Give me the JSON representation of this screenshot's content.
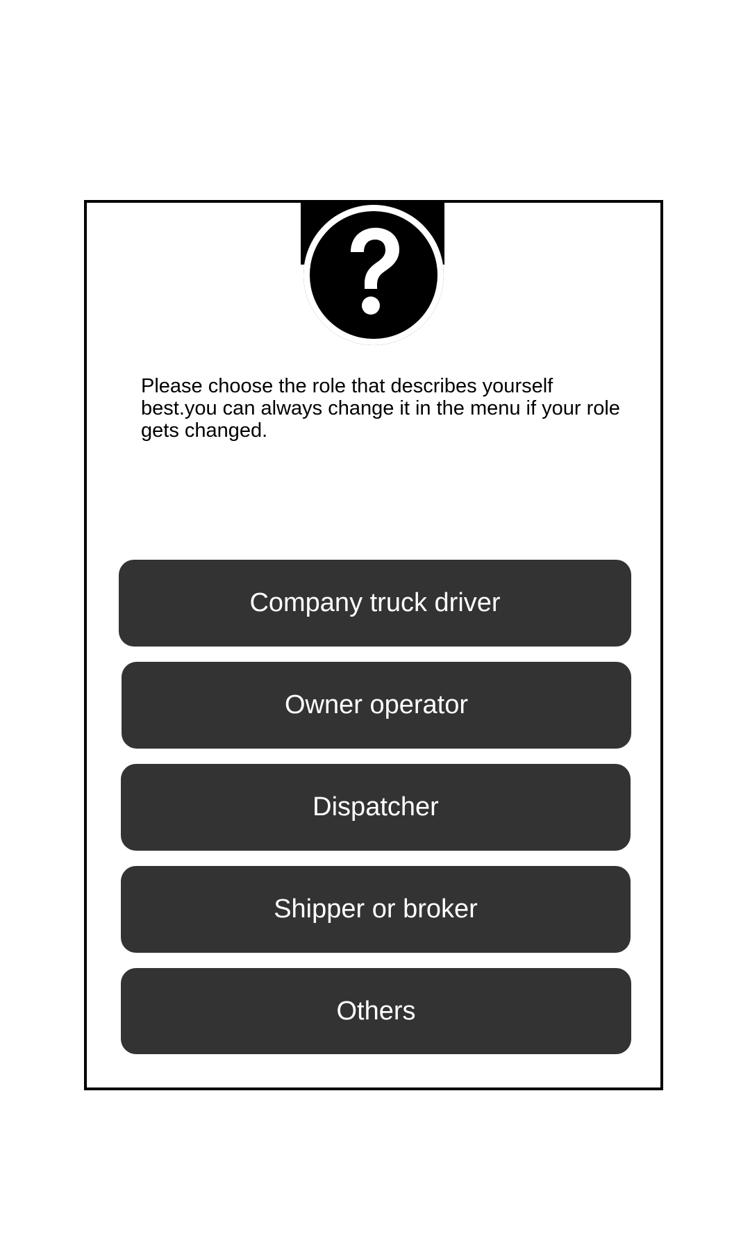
{
  "dialog": {
    "icon": "question-mark-icon",
    "message": "Please choose the role that describes yourself best.you can always change it in the menu if your role gets changed.",
    "roles": [
      {
        "label": "Company truck driver"
      },
      {
        "label": "Owner operator"
      },
      {
        "label": "Dispatcher"
      },
      {
        "label": "Shipper or broker"
      },
      {
        "label": "Others"
      }
    ]
  },
  "colors": {
    "button_background": "#333333",
    "button_text": "#ffffff",
    "border": "#000000",
    "background": "#ffffff"
  }
}
